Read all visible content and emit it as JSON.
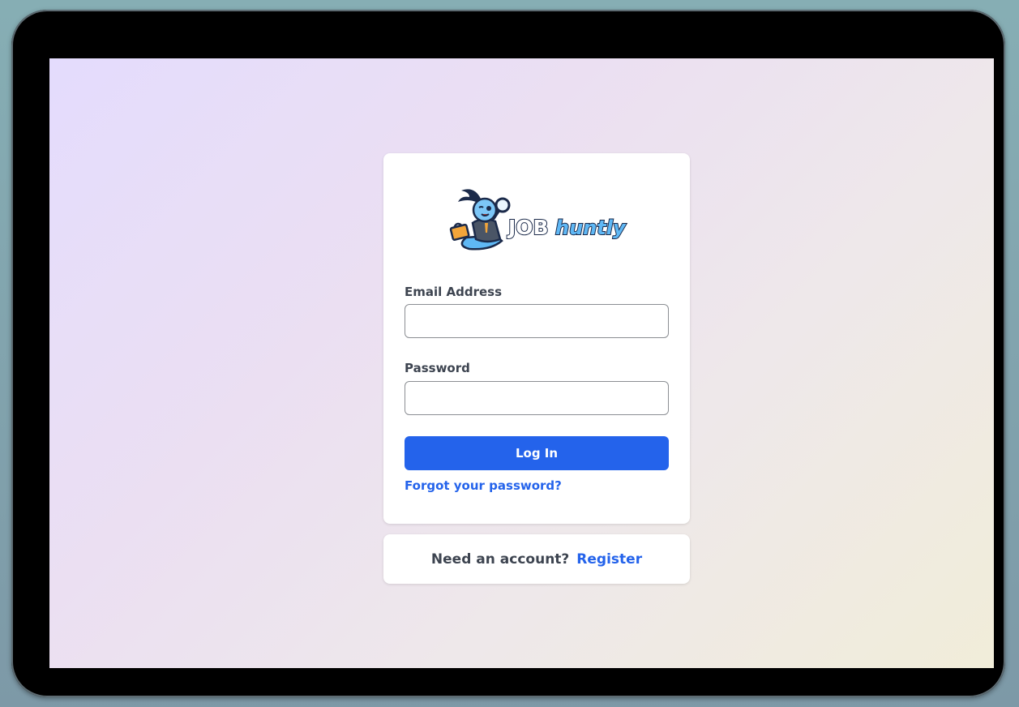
{
  "brand": {
    "logo_text_prefix": "JOB",
    "logo_text_suffix": "huntly",
    "logo_icon": "genie-mascot-icon"
  },
  "login_form": {
    "email_label": "Email Address",
    "email_value": "",
    "password_label": "Password",
    "password_value": "",
    "submit_label": "Log In",
    "forgot_link": "Forgot your password?"
  },
  "register_prompt": {
    "text": "Need an account?",
    "link": "Register"
  },
  "colors": {
    "primary": "#2463eb",
    "text": "#3d4450",
    "logo_dark": "#1b2a4a",
    "logo_light": "#5fb8f5"
  }
}
